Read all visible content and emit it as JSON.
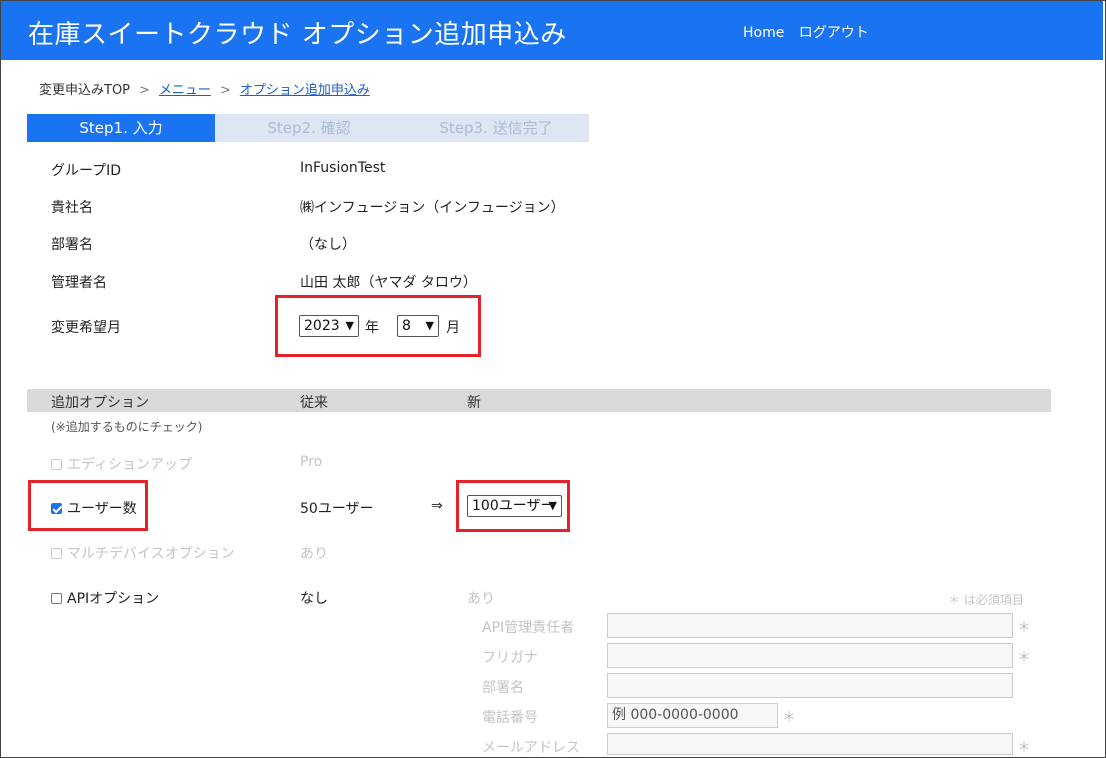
{
  "header": {
    "title": "在庫スイートクラウド オプション追加申込み",
    "nav": [
      "Home",
      "ログアウト"
    ]
  },
  "breadcrumb": {
    "top": "変更申込みTOP",
    "menu": "メニュー",
    "current": "オプション追加申込み",
    "separator": ">"
  },
  "steps": [
    "Step1. 入力",
    "Step2. 確認",
    "Step3. 送信完了"
  ],
  "info": {
    "group_id_label": "グループID",
    "group_id_value": "InFusionTest",
    "company_label": "貴社名",
    "company_value": "㈱インフュージョン（インフュージョン）",
    "dept_label": "部署名",
    "dept_value": "（なし）",
    "admin_label": "管理者名",
    "admin_value": "山田 太郎（ヤマダ タロウ）",
    "change_month_label": "変更希望月",
    "year_value": "2023",
    "year_unit": "年",
    "month_value": "8",
    "month_unit": "月"
  },
  "options_table": {
    "col_option": "追加オプション",
    "col_current": "従来",
    "col_new": "新",
    "note": "(※追加するものにチェック)",
    "rows": [
      {
        "label": "エディションアップ",
        "current": "Pro",
        "checked": false,
        "disabled": true
      },
      {
        "label": "ユーザー数",
        "current": "50ユーザー",
        "arrow": "⇒",
        "new_value": "100ユーザー",
        "checked": true,
        "disabled": false
      },
      {
        "label": "マルチデバイスオプション",
        "current": "あり",
        "checked": false,
        "disabled": true
      },
      {
        "label": "APIオプション",
        "current": "なし",
        "new_value": "あり",
        "checked": false,
        "disabled": false
      }
    ]
  },
  "api_form": {
    "required_note": "＊ は必須項目",
    "required_mark": "＊",
    "fields": [
      {
        "label": "API管理責任者",
        "required": true
      },
      {
        "label": "フリガナ",
        "required": true
      },
      {
        "label": "部署名",
        "required": false
      },
      {
        "label": "電話番号",
        "placeholder": "例 000-0000-0000",
        "required": true
      },
      {
        "label": "メールアドレス",
        "required": true
      }
    ]
  },
  "colors": {
    "header_bg": "#1a73f0",
    "step_inactive_bg": "#dde6f2",
    "highlight_border": "#e4222b"
  }
}
